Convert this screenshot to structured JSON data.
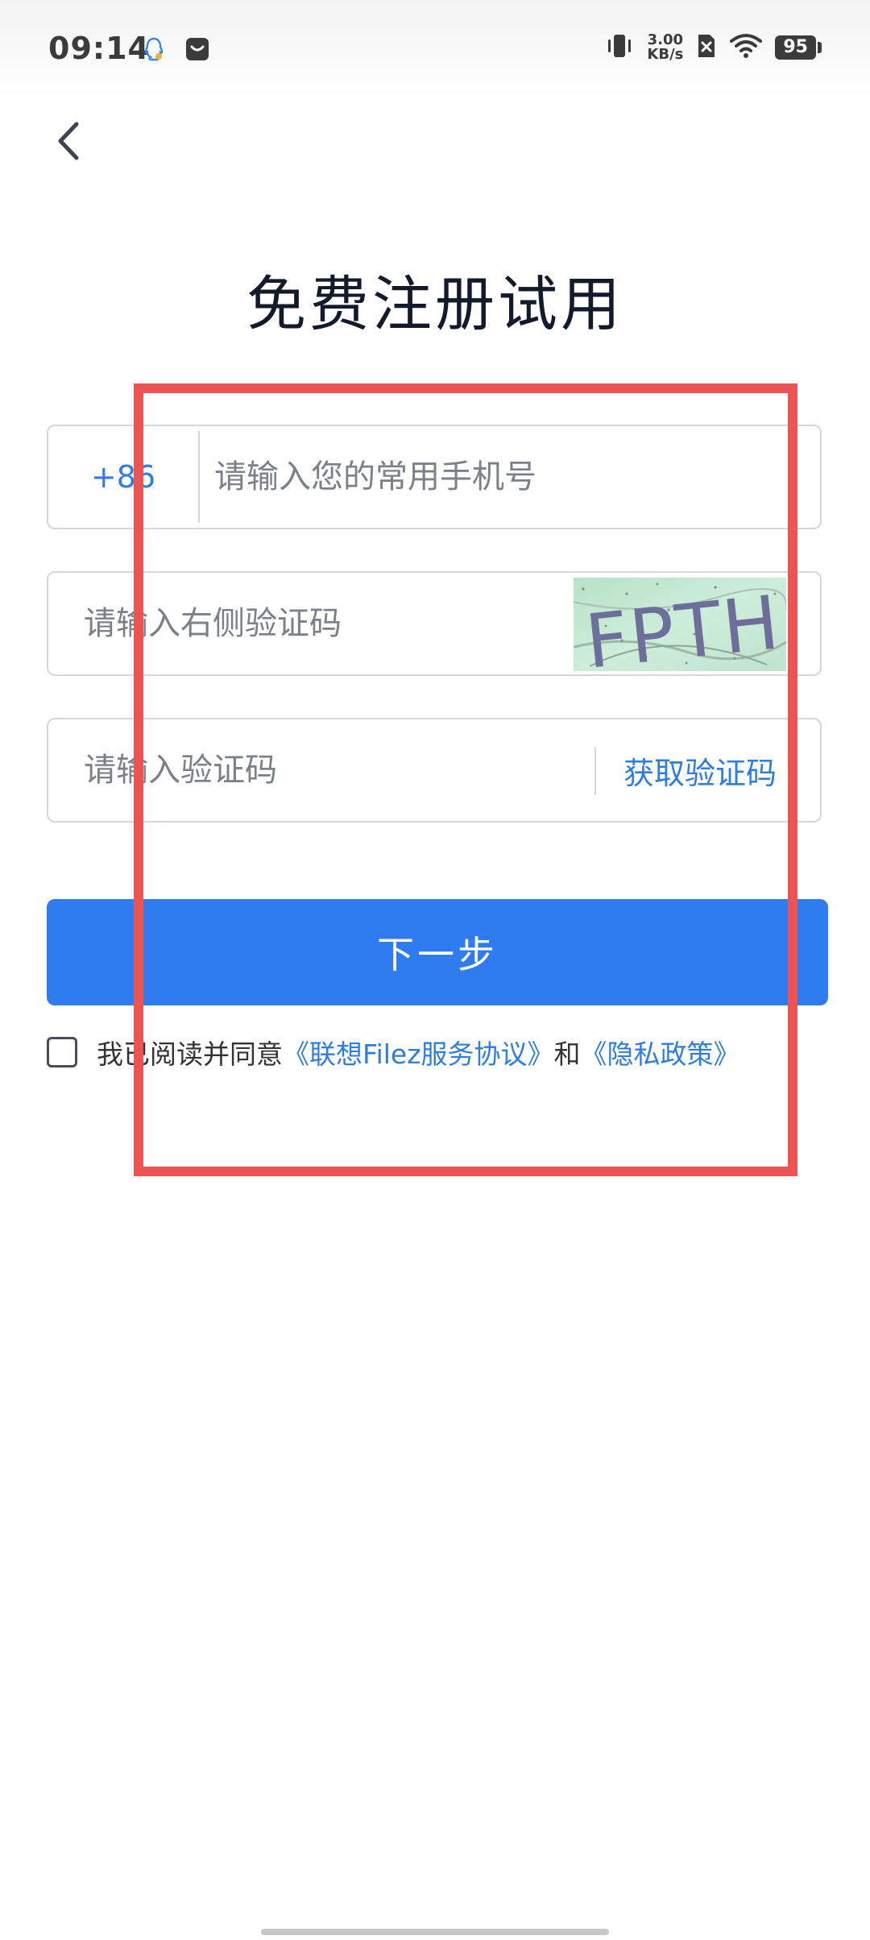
{
  "status_bar": {
    "time": "09:14",
    "net_speed_value": "3.00",
    "net_speed_unit": "KB/s",
    "battery_level": "95"
  },
  "page": {
    "title": "免费注册试用"
  },
  "form": {
    "country_code": "+86",
    "phone_placeholder": "请输入您的常用手机号",
    "captcha_placeholder": "请输入右侧验证码",
    "captcha_text": "FPTH",
    "sms_placeholder": "请输入验证码",
    "get_code_label": "获取验证码",
    "next_label": "下一步"
  },
  "agreement": {
    "prefix": "我已阅读并同意",
    "service_link": "《联想Filez服务协议》",
    "and": "和",
    "privacy_link": "《隐私政策》",
    "checked": false
  },
  "colors": {
    "accent": "#2e7cf0",
    "link": "#2f7de1",
    "highlight": "#ec5353"
  }
}
